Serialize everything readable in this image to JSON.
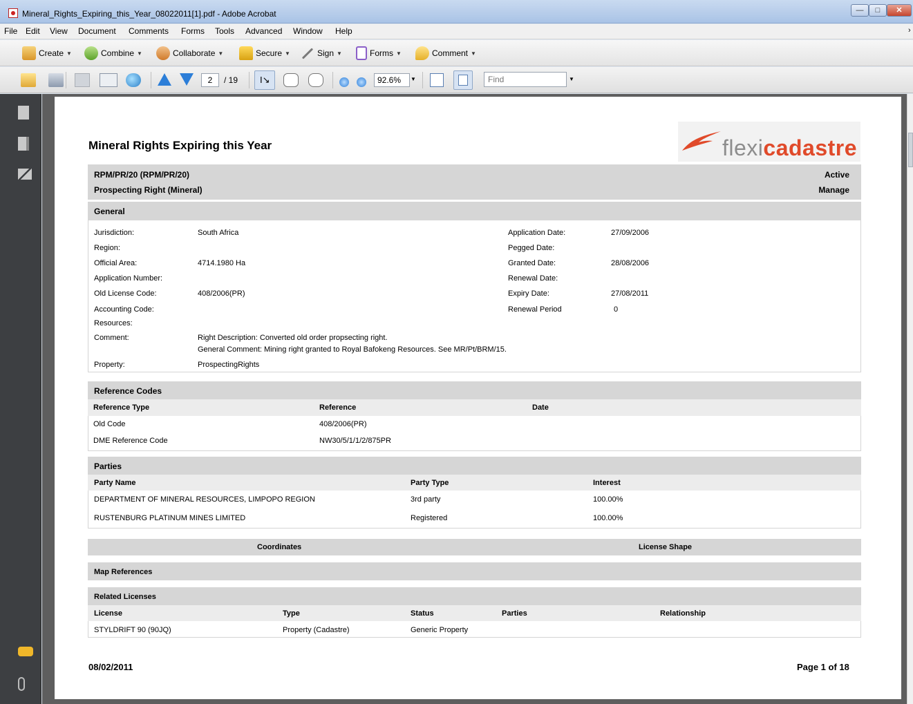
{
  "window": {
    "title": "Mineral_Rights_Expiring_this_Year_08022011[1].pdf - Adobe Acrobat"
  },
  "menu": [
    "File",
    "Edit",
    "View",
    "Document",
    "Comments",
    "Forms",
    "Tools",
    "Advanced",
    "Window",
    "Help"
  ],
  "tasks": {
    "create": "Create",
    "combine": "Combine",
    "collaborate": "Collaborate",
    "secure": "Secure",
    "sign": "Sign",
    "forms": "Forms",
    "comment": "Comment"
  },
  "nav": {
    "page_current": "2",
    "page_total": "/ 19",
    "zoom": "92.6%",
    "find_placeholder": "Find"
  },
  "doc": {
    "title": "Mineral Rights Expiring this Year",
    "logo": {
      "part1": "flexi",
      "part2": "cadastre"
    },
    "header": {
      "code": "RPM/PR/20 (RPM/PR/20)",
      "type": "Prospecting Right (Mineral)",
      "status": "Active",
      "action": "Manage"
    },
    "general": {
      "heading": "General",
      "left": [
        {
          "label": "Jurisdiction:",
          "value": "South Africa"
        },
        {
          "label": "Region:",
          "value": ""
        },
        {
          "label": "Official Area:",
          "value": "4714.1980 Ha"
        },
        {
          "label": "Application Number:",
          "value": ""
        },
        {
          "label": "Old License Code:",
          "value": "408/2006(PR)"
        },
        {
          "label": "Accounting Code:",
          "value": ""
        },
        {
          "label": "Resources:",
          "value": ""
        }
      ],
      "right": [
        {
          "label": "Application Date:",
          "value": "27/09/2006"
        },
        {
          "label": "Pegged Date:",
          "value": ""
        },
        {
          "label": "Granted Date:",
          "value": "28/08/2006"
        },
        {
          "label": "Renewal Date:",
          "value": ""
        },
        {
          "label": "Expiry Date:",
          "value": "27/08/2011"
        },
        {
          "label": "Renewal Period",
          "value": "0"
        }
      ],
      "comment_label": "Comment:",
      "comment_line1": "Right Description: Converted old order propsecting right.",
      "comment_line2": "General Comment: Mining right granted to Royal Bafokeng Resources. See MR/Pt/BRM/15.",
      "property_label": "Property:",
      "property_value": "ProspectingRights"
    },
    "reference_codes": {
      "heading": "Reference Codes",
      "columns": [
        "Reference Type",
        "Reference",
        "Date"
      ],
      "rows": [
        [
          "Old Code",
          "408/2006(PR)",
          ""
        ],
        [
          "DME Reference Code",
          "NW30/5/1/1/2/875PR",
          ""
        ]
      ]
    },
    "parties": {
      "heading": "Parties",
      "columns": [
        "Party Name",
        "Party Type",
        "Interest"
      ],
      "rows": [
        [
          "DEPARTMENT OF MINERAL RESOURCES, LIMPOPO REGION",
          "3rd party",
          "100.00%"
        ],
        [
          "RUSTENBURG PLATINUM MINES LIMITED",
          "Registered",
          "100.00%"
        ]
      ]
    },
    "coordinates_heading": "Coordinates",
    "license_shape_heading": "License Shape",
    "map_references_heading": "Map References",
    "related_licenses": {
      "heading": "Related Licenses",
      "columns": [
        "License",
        "Type",
        "Status",
        "Parties",
        "Relationship"
      ],
      "rows": [
        [
          "STYLDRIFT 90 (90JQ)",
          "Property (Cadastre)",
          "Generic Property",
          "",
          ""
        ]
      ]
    },
    "footer": {
      "date": "08/02/2011",
      "page": "Page 1 of 18"
    }
  }
}
